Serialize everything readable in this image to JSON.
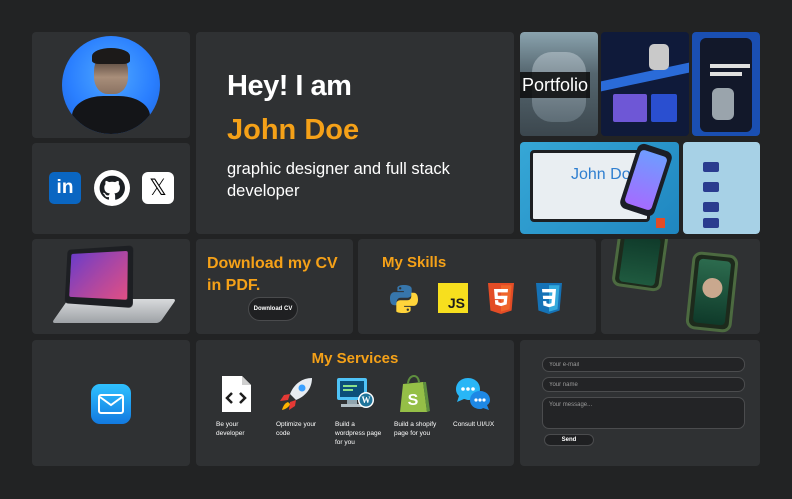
{
  "hero": {
    "greeting": "Hey! I am",
    "name": "John Doe",
    "role": "graphic designer and full stack developer"
  },
  "portfolio": {
    "label": "Portfolio",
    "preview_name": "John Doe"
  },
  "social": {
    "linkedin_glyph": "in",
    "x_glyph": "𝕏",
    "icons": [
      "linkedin-icon",
      "github-icon",
      "x-icon"
    ]
  },
  "cv": {
    "title": "Download my CV in PDF.",
    "button_label": "Download CV"
  },
  "skills": {
    "title": "My Skills",
    "js_glyph": "JS",
    "icons": [
      "python-icon",
      "javascript-icon",
      "html5-icon",
      "css3-icon"
    ]
  },
  "services": {
    "title": "My Services",
    "items": [
      {
        "label": "Be your developer",
        "icon": "code-file-icon"
      },
      {
        "label": "Optimize your code",
        "icon": "rocket-icon"
      },
      {
        "label": "Build a wordpress page for you",
        "icon": "wordpress-icon"
      },
      {
        "label": "Build a shopify page for you",
        "icon": "shopify-icon"
      },
      {
        "label": "Consult UI/UX",
        "icon": "chat-icon"
      }
    ]
  },
  "contact_form": {
    "email_placeholder": "Your e-mail",
    "name_placeholder": "Your name",
    "message_placeholder": "Your message...",
    "send_label": "Send"
  },
  "colors": {
    "accent": "#f5a118",
    "card": "#2f3133",
    "background": "#222324"
  }
}
